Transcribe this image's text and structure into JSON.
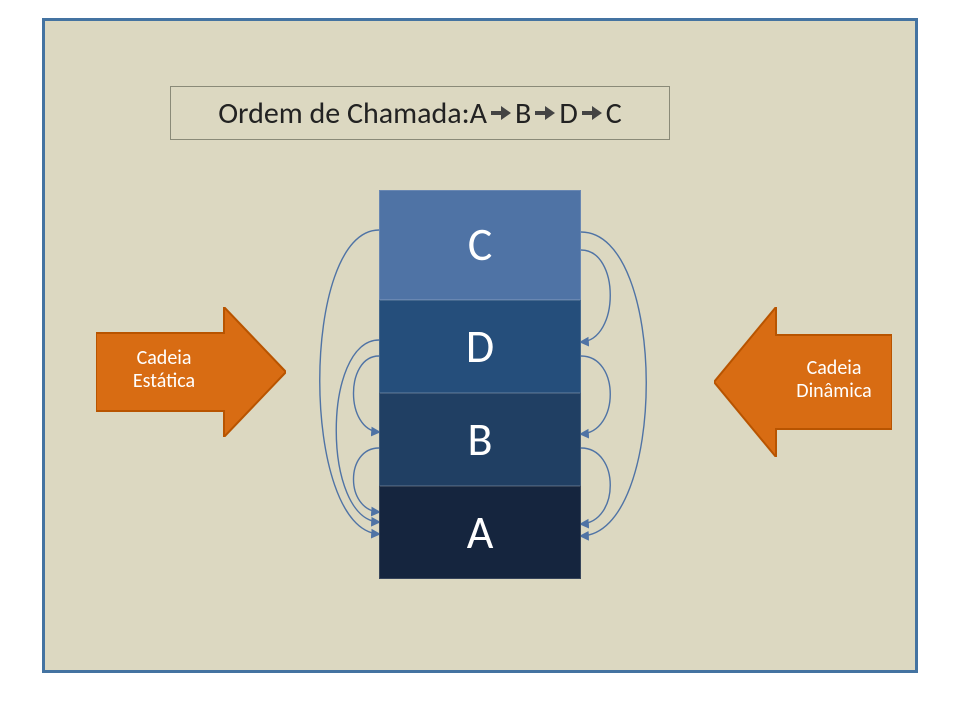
{
  "title": {
    "label_prefix": "Ordem de Chamada: ",
    "sequence": [
      "A",
      "B",
      "D",
      "C"
    ]
  },
  "stack": {
    "cells": [
      {
        "id": "C",
        "label": "C",
        "color": "#4f73a5"
      },
      {
        "id": "D",
        "label": "D",
        "color": "#254e7b"
      },
      {
        "id": "B",
        "label": "B",
        "color": "#203f63"
      },
      {
        "id": "A",
        "label": "A",
        "color": "#15253e"
      }
    ]
  },
  "left_arrow": {
    "line1": "Cadeia",
    "line2": "Estática"
  },
  "right_arrow": {
    "line1": "Cadeia",
    "line2": "Dinâmica"
  },
  "colors": {
    "frame_border": "#4473a1",
    "canvas_bg": "#dcd8c1",
    "arrow_fill": "#d86c13",
    "curve_stroke": "#4f73a5"
  },
  "static_chain": {
    "description": "left-side curved links (Cadeia Estática)",
    "links": [
      {
        "from": "C",
        "to": "A"
      },
      {
        "from": "D",
        "to": "A"
      },
      {
        "from": "B",
        "to": "A"
      },
      {
        "from": "D",
        "to": "B"
      }
    ]
  },
  "dynamic_chain": {
    "description": "right-side curved links (Cadeia Dinâmica)",
    "links": [
      {
        "from": "C",
        "to": "D"
      },
      {
        "from": "D",
        "to": "B"
      },
      {
        "from": "B",
        "to": "A"
      },
      {
        "from": "C",
        "to": "A"
      }
    ]
  }
}
